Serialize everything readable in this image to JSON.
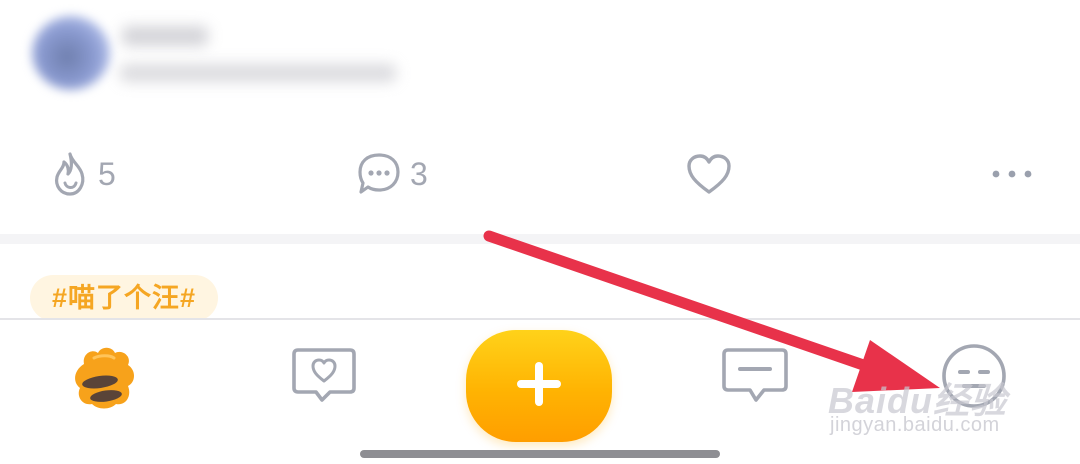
{
  "post": {
    "actions": {
      "hot_count": "5",
      "comment_count": "3"
    }
  },
  "topic_tag": "#喵了个汪#",
  "tabbar": {
    "items": [
      {
        "icon": "paw-icon"
      },
      {
        "icon": "heart-chat-icon"
      },
      {
        "icon": "plus-icon"
      },
      {
        "icon": "message-icon"
      },
      {
        "icon": "profile-face-icon"
      }
    ]
  },
  "colors": {
    "accent_orange": "#ffb302",
    "tag_text": "#f5a623",
    "icon_gray": "#9aa0ad",
    "annotation_red": "#e8324a"
  },
  "watermark": {
    "brand": "Baidu经验",
    "url": "jingyan.baidu.com"
  }
}
